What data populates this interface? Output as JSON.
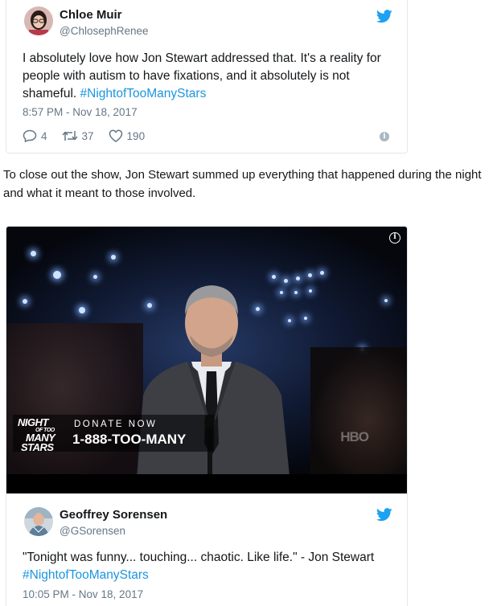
{
  "tweet1": {
    "author_name": "Chloe Muir",
    "author_handle": "@ChlosephRenee",
    "text_before": "I absolutely love how Jon Stewart addressed that. It's a reality for people with autism to have fixations, and it absolutely is not shameful. ",
    "hashtag": "#NightofTooManyStars",
    "timestamp": "8:57 PM - Nov 18, 2017",
    "replies": "4",
    "retweets": "37",
    "likes": "190",
    "info_glyph": "i"
  },
  "article": {
    "paragraph": "To close out the show, Jon Stewart summed up everything that happened during the night and what it meant to those involved."
  },
  "video": {
    "banner_logo": [
      "NIGHT",
      "MANY",
      "STARS"
    ],
    "banner_logo_small": "OF TOO",
    "donate_label": "DONATE NOW",
    "phone": "1-888-TOO-MANY",
    "network_watermark": "HBO",
    "info_glyph": "i"
  },
  "tweet2": {
    "author_name": "Geoffrey Sorensen",
    "author_handle": "@GSorensen",
    "text_before": "\"Tonight was funny... touching... chaotic. Like life.\" - Jon Stewart",
    "hashtag": "#NightofTooManyStars",
    "timestamp": "10:05 PM - Nov 18, 2017"
  },
  "colors": {
    "twitter_blue": "#1da1f2",
    "link_blue": "#1b95e0",
    "muted_gray": "#657786",
    "border": "#e1e8ed"
  },
  "icons": {
    "bird": "twitter-bird-icon",
    "reply": "reply-icon",
    "retweet": "retweet-icon",
    "like": "heart-icon",
    "info": "info-icon"
  }
}
